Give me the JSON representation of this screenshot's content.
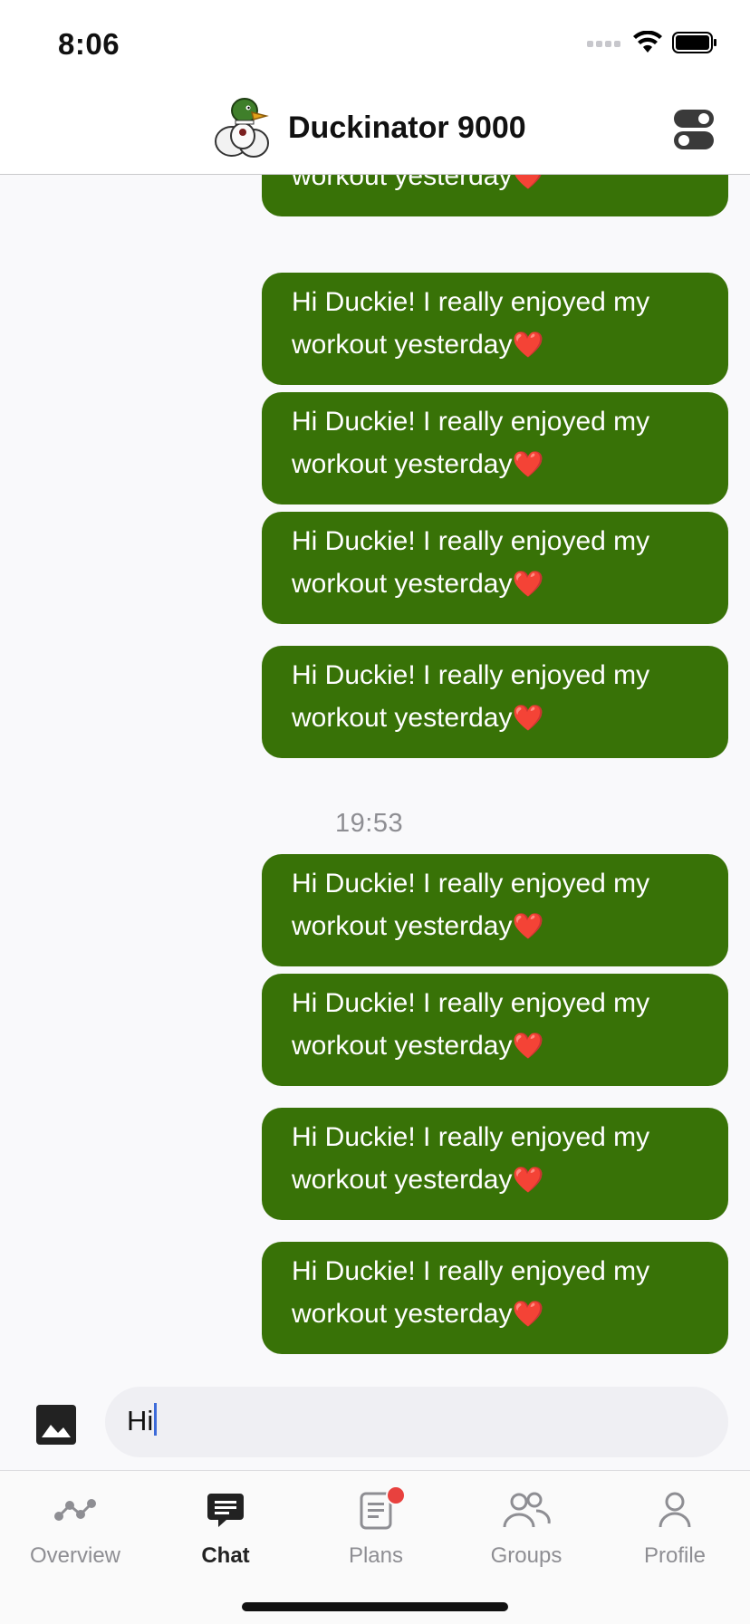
{
  "status_bar": {
    "time": "8:06"
  },
  "header": {
    "title": "Duckinator 9000",
    "avatar_icon": "duck-mascot-icon",
    "toggle_icon": "toggle-settings-icon"
  },
  "chat": {
    "messages": [
      {
        "text": "Hi Duckie! I really enjoyed my workout yesterday",
        "emoji": "❤️"
      },
      {
        "text": "Hi Duckie! I really enjoyed my workout yesterday",
        "emoji": "❤️"
      },
      {
        "text": "Hi Duckie! I really enjoyed my workout yesterday",
        "emoji": "❤️"
      },
      {
        "text": "Hi Duckie! I really enjoyed my workout yesterday",
        "emoji": "❤️"
      },
      {
        "text": "Hi Duckie! I really enjoyed my workout yesterday",
        "emoji": "❤️"
      },
      {
        "text": "Hi Duckie! I really enjoyed my workout yesterday",
        "emoji": "❤️"
      },
      {
        "text": "Hi Duckie! I really enjoyed my workout yesterday",
        "emoji": "❤️"
      },
      {
        "text": "Hi Duckie! I really enjoyed my workout yesterday",
        "emoji": "❤️"
      },
      {
        "text": "Hi Duckie! I really enjoyed my workout yesterday",
        "emoji": "❤️"
      }
    ],
    "timestamp": "19:53",
    "bubble_color": "#387207"
  },
  "composer": {
    "input_value": "Hi",
    "image_icon": "image-icon"
  },
  "tabbar": {
    "tabs": [
      {
        "label": "Overview",
        "icon": "overview-graph-icon",
        "active": false
      },
      {
        "label": "Chat",
        "icon": "chat-bubble-icon",
        "active": true
      },
      {
        "label": "Plans",
        "icon": "plans-clipboard-icon",
        "active": false,
        "badge": true
      },
      {
        "label": "Groups",
        "icon": "groups-people-icon",
        "active": false
      },
      {
        "label": "Profile",
        "icon": "profile-person-icon",
        "active": false
      }
    ],
    "badge_color": "#e8413e"
  }
}
